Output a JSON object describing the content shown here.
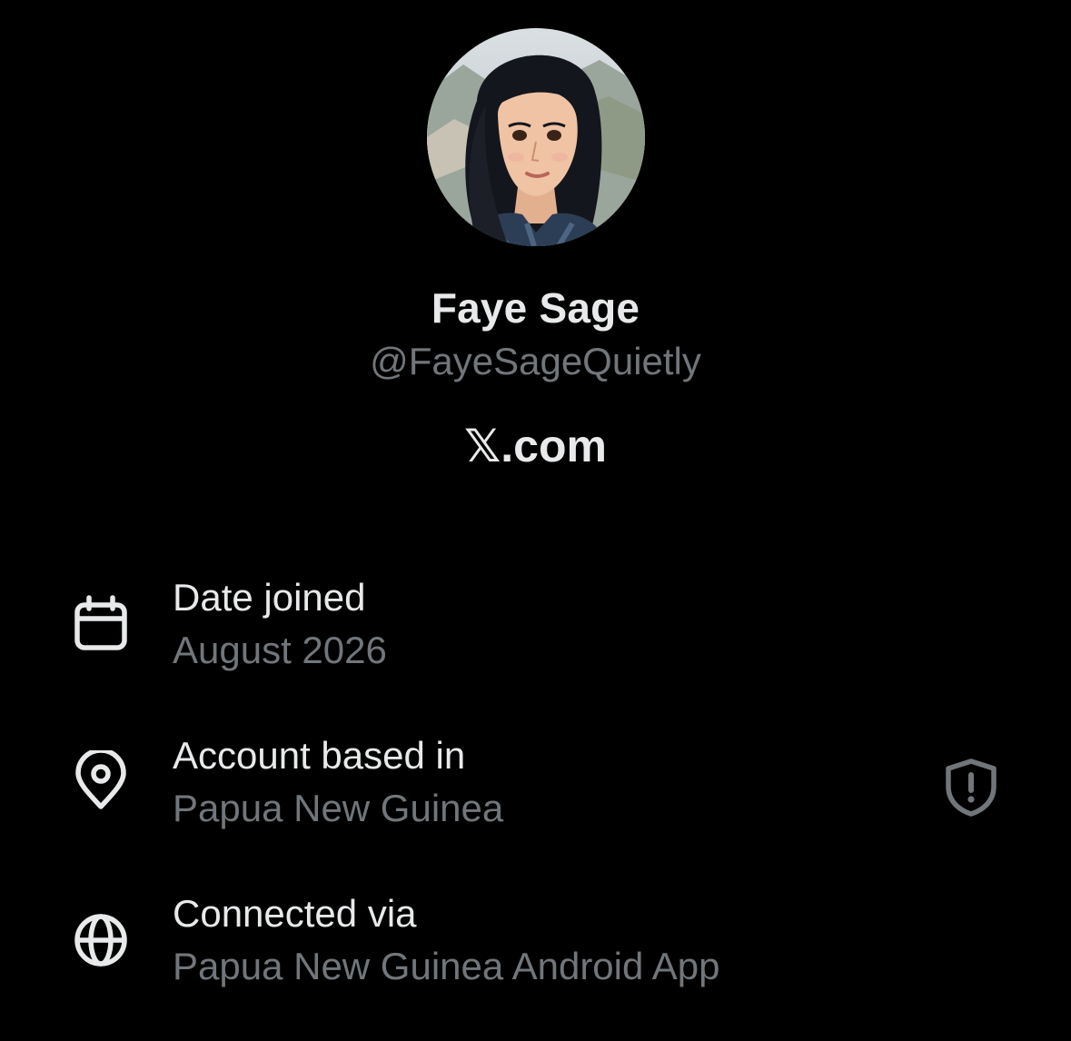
{
  "profile": {
    "display_name": "Faye Sage",
    "handle": "@FayeSageQuietly",
    "site": "𝕏.com",
    "avatar": "illustrated-portrait-avatar"
  },
  "details": [
    {
      "icon": "calendar-icon",
      "title": "Date joined",
      "value": "August 2026"
    },
    {
      "icon": "location-pin-icon",
      "title": "Account based in",
      "value": "Papua New Guinea",
      "trailing_icon": "shield-alert-icon"
    },
    {
      "icon": "globe-icon",
      "title": "Connected via",
      "value": "Papua New Guinea Android App"
    }
  ],
  "colors": {
    "background": "#000000",
    "primary_text": "#e7e9ea",
    "secondary_text": "#71767b"
  }
}
